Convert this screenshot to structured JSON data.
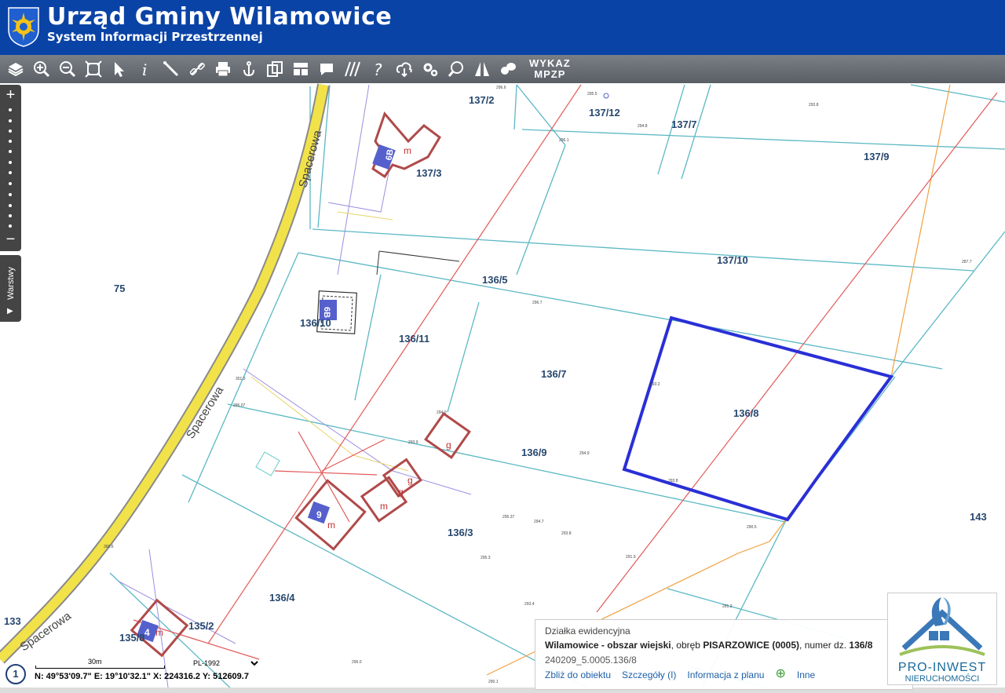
{
  "header": {
    "title": "Urząd Gminy Wilamowice",
    "subtitle": "System Informacji Przestrzennej"
  },
  "toolbar": {
    "icons": [
      "layers-icon",
      "zoom-in-icon",
      "zoom-out-icon",
      "full-extent-icon",
      "select-icon",
      "info-icon",
      "measure-icon",
      "link-icon",
      "print-icon",
      "anchor-icon",
      "copy-icon",
      "layout-icon",
      "comment-icon",
      "hatch-icon",
      "help-icon",
      "cloud-download-icon",
      "settings-icon",
      "search-icon",
      "road-icon",
      "chat-icon"
    ],
    "wykaz_line1": "WYKAZ",
    "wykaz_line2": "MPZP"
  },
  "sidebar": {
    "zoom_in": "+",
    "zoom_out": "−",
    "layers_label": "Warstwy"
  },
  "map": {
    "street_label": "Spacerowa",
    "parcels": [
      "137/2",
      "137/12",
      "137/7",
      "137/9",
      "137/3",
      "137/10",
      "136/5",
      "75",
      "136/10",
      "136/11",
      "136/7",
      "136/8",
      "136/9",
      "136/3",
      "143",
      "136/4",
      "135/2",
      "135/8",
      "133"
    ],
    "building_codes": [
      "m",
      "g",
      "6B",
      "9",
      "4"
    ],
    "elevations": [
      "296.6",
      "295.5",
      "294.8",
      "296.1",
      "293.8",
      "296.7",
      "287.7",
      "294.0",
      "293.2",
      "294.9",
      "293.9",
      "295.37",
      "294.7",
      "293.8",
      "295.3",
      "291.9",
      "293.4",
      "291.2",
      "296.0",
      "290.1",
      "301.3",
      "300.6",
      "295.07",
      "293.8",
      "290.5"
    ],
    "highlight_color": "#2a2fd6",
    "parcel_line_color": "#5bb8c4",
    "building_color": "#b04a4a",
    "road_color": "#f2e24a"
  },
  "bottom": {
    "info_number": "1",
    "scale_label": "30m",
    "crs_selected": "PL-1992",
    "coords": "N: 49°53'09.7\"  E: 19°10'32.1\"  X: 224316.2  Y: 512609.7"
  },
  "popup": {
    "title": "Działka ewidencyjna",
    "name_bold": "Wilamowice - obszar wiejski",
    "sep1": ", obręb ",
    "obreb_bold": "PISARZOWICE (0005)",
    "sep2": ", numer dz. ",
    "number_bold": "136/8",
    "id": "240209_5.0005.136/8",
    "link_zoom": "Zbliż do obiektu",
    "link_details": "Szczegóły (I)",
    "link_plan": "Informacja z planu",
    "link_other": "Inne"
  },
  "logo": {
    "name": "PRO-INWEST",
    "tagline": "NIERUCHOMOŚCI"
  }
}
